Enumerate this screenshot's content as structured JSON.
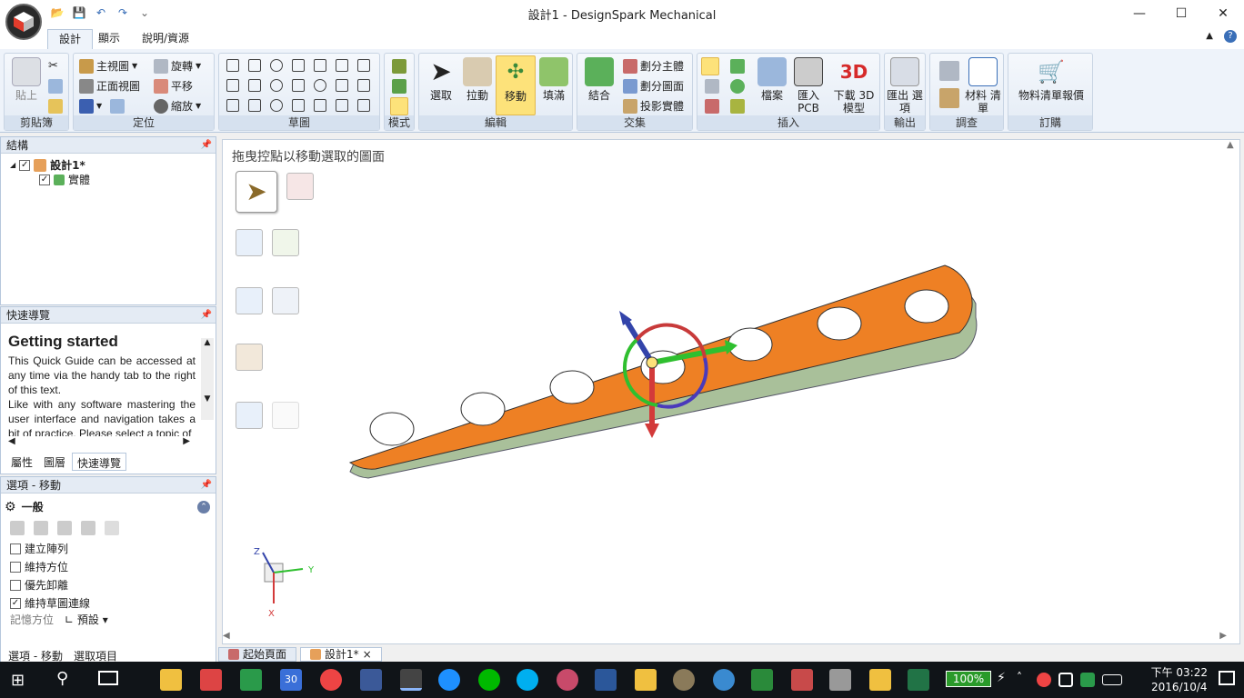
{
  "window": {
    "title": "設計1 - DesignSpark Mechanical",
    "minimize": "—",
    "maximize": "☐",
    "close": "✕"
  },
  "ribbon_tabs": [
    "設計",
    "顯示",
    "說明/資源"
  ],
  "ribbon": {
    "clipboard": {
      "label": "剪貼簿",
      "paste": "貼上"
    },
    "orient": {
      "label": "定位",
      "home_view": "主視圖",
      "front_view": "正面視圖",
      "rotate": "旋轉",
      "pan": "平移",
      "zoom": "縮放"
    },
    "sketch": {
      "label": "草圖"
    },
    "mode": {
      "label": "模式"
    },
    "edit": {
      "label": "編輯",
      "select": "選取",
      "pull": "拉動",
      "move": "移動",
      "fill": "填滿"
    },
    "intersect": {
      "label": "交集",
      "combine": "結合",
      "split_body": "劃分主體",
      "split_face": "劃分圖面",
      "project": "投影實體"
    },
    "insert": {
      "label": "插入",
      "file": "檔案",
      "import_pcb": "匯入 PCB",
      "download_3d": "下載 3D 模型",
      "badge_3d": "3D"
    },
    "output": {
      "label": "輸出",
      "export": "匯出 選項"
    },
    "investigate": {
      "label": "調查",
      "bom": "材料 清單"
    },
    "order": {
      "label": "訂購",
      "bom_quote": "物料清單報價"
    }
  },
  "structure_panel": {
    "title": "結構",
    "root": "設計1*",
    "child": "實體"
  },
  "quick_guide": {
    "title": "快速導覽",
    "heading": "Getting started",
    "text1": "This Quick Guide can be accessed at any time via the handy tab to the right of this text.",
    "text2": "Like with any software mastering the user interface and navigation takes a bit of practice. Please select a topic of",
    "tabs": [
      "屬性",
      "圖層",
      "快速導覽"
    ]
  },
  "options_panel": {
    "title": "選項 - 移動",
    "section": "一般",
    "options": [
      {
        "label": "建立陣列",
        "checked": false
      },
      {
        "label": "維持方位",
        "checked": false
      },
      {
        "label": "優先卸離",
        "checked": false
      },
      {
        "label": "維持草圖連線",
        "checked": true
      }
    ],
    "memory_label": "記憶方位",
    "memory_value": "預設",
    "bottom_tabs": [
      "選項 - 移動",
      "選取項目"
    ]
  },
  "canvas": {
    "hint": "拖曳控點以移動選取的圖面",
    "axis_x": "X",
    "axis_y": "Y",
    "axis_z": "Z"
  },
  "doc_tabs": [
    {
      "label": "起始頁面"
    },
    {
      "label": "設計1*",
      "close": "×"
    }
  ],
  "taskbar": {
    "battery": "100%",
    "time": "下午 03:22",
    "date": "2016/10/4",
    "calendar_day": "30"
  },
  "colors": {
    "part_orange": "#ee8024",
    "part_side": "#a9c09a",
    "ribbon_bg": "#eef3fa",
    "active_btn": "#fde27a"
  }
}
